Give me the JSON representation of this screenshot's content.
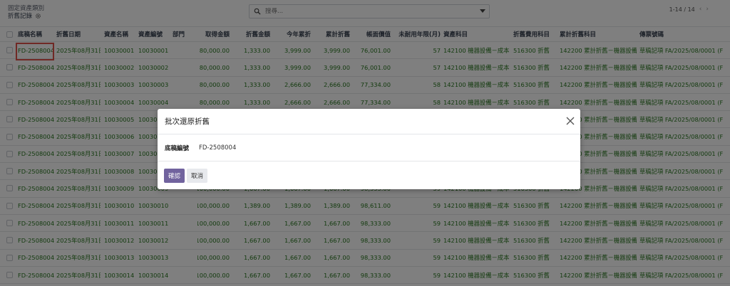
{
  "breadcrumb": {
    "parent": "固定資產類別",
    "current": "折舊記錄"
  },
  "search": {
    "placeholder": "搜尋..."
  },
  "pager": {
    "value": "1-14 / 14"
  },
  "table": {
    "headers": [
      "底稿名稱",
      "折舊日期",
      "資產名稱",
      "資產編號",
      "部門",
      "取得金額",
      "折舊金額",
      "今年累折",
      "累計折舊",
      "帳面價值",
      "未耐用年限(月)",
      "資產科目",
      "折舊費用科目",
      "累計折舊科目",
      "傳票號碼"
    ],
    "rows": [
      [
        "FD-2508004",
        "2025年08月31日",
        "10030001",
        "10030001",
        "",
        "80,000.00",
        "1,333.00",
        "3,999.00",
        "3,999.00",
        "76,001.00",
        "57",
        "142100 機器設備－成本",
        "516300 折舊",
        "142200 累計折舊－機器設備",
        "草稿記項 FA/2025/08/0001 (F"
      ],
      [
        "FD-2508004",
        "2025年08月31日",
        "10030002",
        "10030002",
        "",
        "80,000.00",
        "1,333.00",
        "3,999.00",
        "3,999.00",
        "76,001.00",
        "57",
        "142100 機器設備－成本",
        "516300 折舊",
        "142200 累計折舊－機器設備",
        "草稿記項 FA/2025/08/0001 (F"
      ],
      [
        "FD-2508004",
        "2025年08月31日",
        "10030003",
        "10030003",
        "",
        "80,000.00",
        "1,333.00",
        "2,666.00",
        "2,666.00",
        "77,334.00",
        "58",
        "142100 機器設備－成本",
        "516300 折舊",
        "142200 累計折舊－機器設備",
        "草稿記項 FA/2025/08/0001 (F"
      ],
      [
        "FD-2508004",
        "2025年08月31日",
        "10030004",
        "10030004",
        "",
        "80,000.00",
        "1,333.00",
        "2,666.00",
        "2,666.00",
        "77,334.00",
        "58",
        "142100 機器設備－成本",
        "516300 折舊",
        "142200 累計折舊－機器設備",
        "草稿記項 FA/2025/08/0001 (F"
      ],
      [
        "FD-2508004",
        "2025年08月31日",
        "10030005",
        "10030005",
        "",
        "80,000.00",
        "1,333.00",
        "2,666.00",
        "2,666.00",
        "77,334.00",
        "58",
        "142100 機器設備－成本",
        "516300 折舊",
        "142200 累計折舊－機器設備",
        "草稿記項 FA/2025/08/0001 (F"
      ],
      [
        "FD-2508004",
        "2025年08月31日",
        "10030006",
        "10030006",
        "",
        "80,000.00",
        "1,333.00",
        "2,666.00",
        "2,666.00",
        "77,334.00",
        "58",
        "142100 機器設備－成本",
        "516300 折舊",
        "142200 累計折舊－機器設備",
        "草稿記項 FA/2025/08/0001 (F"
      ],
      [
        "FD-2508004",
        "2025年08月31日",
        "10030007",
        "10030007",
        "",
        "80,000.00",
        "1,333.00",
        "2,666.00",
        "2,666.00",
        "77,334.00",
        "58",
        "142100 機器設備－成本",
        "516300 折舊",
        "142200 累計折舊－機器設備",
        "草稿記項 FA/2025/08/0001 (F"
      ],
      [
        "FD-2508004",
        "2025年08月31日",
        "10030008",
        "10030008",
        "",
        "80,000.00",
        "1,333.00",
        "2,666.00",
        "2,666.00",
        "77,334.00",
        "58",
        "142100 機器設備－成本",
        "516300 折舊",
        "142200 累計折舊－機器設備",
        "草稿記項 FA/2025/08/0001 (F"
      ],
      [
        "FD-2508004",
        "2025年08月31日",
        "10030009",
        "10030009",
        "",
        "100,000.00",
        "1,667.00",
        "1,667.00",
        "1,667.00",
        "98,333.00",
        "59",
        "142100 機器設備－成本",
        "516300 折舊",
        "142200 累計折舊－機器設備",
        "草稿記項 FA/2025/08/0001 (F"
      ],
      [
        "FD-2508004",
        "2025年08月31日",
        "10030010",
        "10030010",
        "",
        "100,000.00",
        "1,389.00",
        "1,389.00",
        "1,389.00",
        "98,611.00",
        "59",
        "142100 機器設備－成本",
        "516300 折舊",
        "142200 累計折舊－機器設備",
        "草稿記項 FA/2025/08/0001 (F"
      ],
      [
        "FD-2508004",
        "2025年08月31日",
        "10030011",
        "10030011",
        "",
        "100,000.00",
        "1,667.00",
        "1,667.00",
        "1,667.00",
        "98,333.00",
        "59",
        "142100 機器設備－成本",
        "516300 折舊",
        "142200 累計折舊－機器設備",
        "草稿記項 FA/2025/08/0001 (F"
      ],
      [
        "FD-2508004",
        "2025年08月31日",
        "10030012",
        "10030012",
        "",
        "100,000.00",
        "1,667.00",
        "1,667.00",
        "1,667.00",
        "98,333.00",
        "59",
        "142100 機器設備－成本",
        "516300 折舊",
        "142200 累計折舊－機器設備",
        "草稿記項 FA/2025/08/0001 (F"
      ],
      [
        "FD-2508004",
        "2025年08月31日",
        "10030013",
        "10030013",
        "",
        "100,000.00",
        "1,667.00",
        "1,667.00",
        "1,667.00",
        "98,333.00",
        "59",
        "142100 機器設備－成本",
        "516300 折舊",
        "142200 累計折舊－機器設備",
        "草稿記項 FA/2025/08/0001 (F"
      ],
      [
        "FD-2508004",
        "2025年08月31日",
        "10030014",
        "10030014",
        "",
        "100,000.00",
        "1,667.00",
        "1,667.00",
        "1,667.00",
        "98,333.00",
        "59",
        "142100 機器設備－成本",
        "516300 折舊",
        "142200 累計折舊－機器設備",
        "草稿記項 FA/2025/08/0001 (F"
      ]
    ]
  },
  "modal": {
    "title": "批次還原折舊",
    "field_label": "底稿編號",
    "field_value": "FD-2508004",
    "confirm_label": "確認",
    "cancel_label": "取消"
  },
  "colors": {
    "accent": "#71639e",
    "positive_text": "#28761f",
    "highlight_box": "#e0524a"
  },
  "icons": {
    "settings": "gear-icon",
    "search": "search-icon",
    "dropdown": "caret-down-icon",
    "close": "close-icon"
  }
}
